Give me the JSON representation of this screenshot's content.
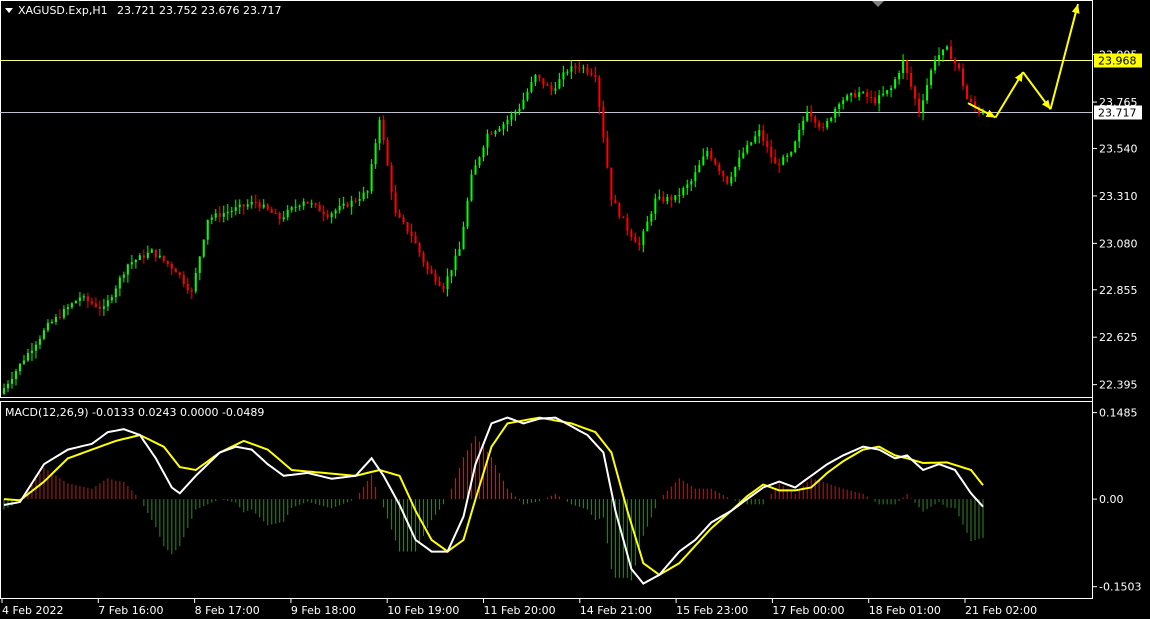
{
  "header": {
    "symbol": "XAGUSD.Exp,H1",
    "ohlc": "23.721 23.752 23.676 23.717"
  },
  "macd_header": "MACD(12,26,9) -0.0133 0.0243 0.0000 -0.0489",
  "colors": {
    "bull": "#00ff00",
    "bear": "#ff0000",
    "macd_line": "#ffffff",
    "signal_line": "#ffff00",
    "hist_pos": "#b22222",
    "hist_neg": "#2e8b22",
    "arrow": "#ffff00",
    "hline": "#ffff80",
    "hline2": "#c0c0d0",
    "tag_bg": "#ffff00",
    "tag_text": "#000000"
  },
  "chart_data": [
    {
      "type": "candlestick",
      "name": "XAGUSD.Exp,H1",
      "y_ticks": [
        "23.995",
        "23.765",
        "23.540",
        "23.310",
        "23.080",
        "22.855",
        "22.625",
        "22.395"
      ],
      "ylim": [
        22.34,
        24.25
      ],
      "x_labels": [
        "4 Feb 2022",
        "7 Feb 16:00",
        "8 Feb 17:00",
        "9 Feb 18:00",
        "10 Feb 19:00",
        "11 Feb 20:00",
        "14 Feb 21:00",
        "15 Feb 23:00",
        "17 Feb 00:00",
        "18 Feb 01:00",
        "21 Feb 02:00"
      ],
      "price_tags": [
        {
          "label": "23.968",
          "value": 23.968,
          "style": "yellow"
        },
        {
          "label": "23.717",
          "value": 23.717,
          "style": "white"
        }
      ],
      "price_path": [
        [
          0,
          22.35
        ],
        [
          6,
          22.52
        ],
        [
          12,
          22.68
        ],
        [
          20,
          22.82
        ],
        [
          26,
          22.76
        ],
        [
          32,
          22.98
        ],
        [
          38,
          23.04
        ],
        [
          44,
          22.95
        ],
        [
          48,
          22.84
        ],
        [
          52,
          23.2
        ],
        [
          58,
          23.24
        ],
        [
          64,
          23.28
        ],
        [
          70,
          23.2
        ],
        [
          76,
          23.29
        ],
        [
          82,
          23.22
        ],
        [
          88,
          23.28
        ],
        [
          92,
          23.33
        ],
        [
          95,
          23.69
        ],
        [
          99,
          23.22
        ],
        [
          103,
          23.12
        ],
        [
          107,
          22.95
        ],
        [
          111,
          22.87
        ],
        [
          115,
          23.05
        ],
        [
          118,
          23.4
        ],
        [
          122,
          23.61
        ],
        [
          126,
          23.66
        ],
        [
          130,
          23.74
        ],
        [
          134,
          23.89
        ],
        [
          138,
          23.82
        ],
        [
          142,
          23.92
        ],
        [
          145,
          23.94
        ],
        [
          149,
          23.9
        ],
        [
          153,
          23.3
        ],
        [
          157,
          23.15
        ],
        [
          160,
          23.07
        ],
        [
          164,
          23.29
        ],
        [
          169,
          23.3
        ],
        [
          173,
          23.38
        ],
        [
          177,
          23.53
        ],
        [
          182,
          23.38
        ],
        [
          186,
          23.52
        ],
        [
          190,
          23.62
        ],
        [
          194,
          23.46
        ],
        [
          198,
          23.51
        ],
        [
          202,
          23.73
        ],
        [
          206,
          23.63
        ],
        [
          210,
          23.77
        ],
        [
          215,
          23.81
        ],
        [
          219,
          23.77
        ],
        [
          223,
          23.83
        ],
        [
          226,
          23.96
        ],
        [
          230,
          23.72
        ],
        [
          234,
          23.98
        ],
        [
          237,
          24.02
        ],
        [
          240,
          23.92
        ],
        [
          242,
          23.78
        ],
        [
          245,
          23.717
        ]
      ],
      "forecast_arrows": [
        {
          "from": [
            23.76,
            0
          ],
          "to": [
            23.69,
            1
          ]
        },
        {
          "from": [
            23.69,
            1
          ],
          "to": [
            23.91,
            2
          ]
        },
        {
          "from": [
            23.91,
            2
          ],
          "to": [
            23.73,
            3
          ]
        },
        {
          "from": [
            23.73,
            3
          ],
          "to": [
            24.24,
            4
          ]
        }
      ]
    },
    {
      "type": "line",
      "name": "MACD(12,26,9)",
      "y_ticks": [
        "0.1485",
        "0.00",
        "-0.1503"
      ],
      "ylim": [
        -0.168,
        0.165
      ],
      "macd": [
        [
          0,
          -0.01
        ],
        [
          4,
          -0.005
        ],
        [
          10,
          0.06
        ],
        [
          16,
          0.085
        ],
        [
          22,
          0.095
        ],
        [
          26,
          0.115
        ],
        [
          30,
          0.12
        ],
        [
          34,
          0.11
        ],
        [
          38,
          0.07
        ],
        [
          42,
          0.02
        ],
        [
          44,
          0.01
        ],
        [
          48,
          0.04
        ],
        [
          54,
          0.08
        ],
        [
          58,
          0.09
        ],
        [
          62,
          0.085
        ],
        [
          66,
          0.06
        ],
        [
          70,
          0.04
        ],
        [
          76,
          0.045
        ],
        [
          82,
          0.035
        ],
        [
          88,
          0.04
        ],
        [
          92,
          0.07
        ],
        [
          95,
          0.04
        ],
        [
          99,
          -0.01
        ],
        [
          103,
          -0.07
        ],
        [
          107,
          -0.09
        ],
        [
          111,
          -0.09
        ],
        [
          115,
          -0.03
        ],
        [
          118,
          0.06
        ],
        [
          122,
          0.13
        ],
        [
          126,
          0.14
        ],
        [
          130,
          0.13
        ],
        [
          134,
          0.138
        ],
        [
          138,
          0.14
        ],
        [
          142,
          0.125
        ],
        [
          146,
          0.11
        ],
        [
          150,
          0.08
        ],
        [
          153,
          -0.02
        ],
        [
          157,
          -0.12
        ],
        [
          160,
          -0.145
        ],
        [
          164,
          -0.13
        ],
        [
          169,
          -0.09
        ],
        [
          173,
          -0.07
        ],
        [
          177,
          -0.04
        ],
        [
          182,
          -0.02
        ],
        [
          186,
          0.0
        ],
        [
          190,
          0.02
        ],
        [
          194,
          0.03
        ],
        [
          198,
          0.02
        ],
        [
          202,
          0.04
        ],
        [
          206,
          0.06
        ],
        [
          210,
          0.075
        ],
        [
          215,
          0.09
        ],
        [
          219,
          0.085
        ],
        [
          223,
          0.07
        ],
        [
          226,
          0.075
        ],
        [
          230,
          0.05
        ],
        [
          234,
          0.06
        ],
        [
          238,
          0.05
        ],
        [
          242,
          0.01
        ],
        [
          245,
          -0.013
        ]
      ],
      "signal": [
        [
          0,
          0.0
        ],
        [
          4,
          -0.002
        ],
        [
          10,
          0.03
        ],
        [
          16,
          0.07
        ],
        [
          22,
          0.085
        ],
        [
          28,
          0.1
        ],
        [
          34,
          0.11
        ],
        [
          40,
          0.09
        ],
        [
          44,
          0.055
        ],
        [
          48,
          0.05
        ],
        [
          54,
          0.08
        ],
        [
          60,
          0.1
        ],
        [
          66,
          0.085
        ],
        [
          72,
          0.05
        ],
        [
          80,
          0.045
        ],
        [
          88,
          0.04
        ],
        [
          94,
          0.05
        ],
        [
          99,
          0.04
        ],
        [
          103,
          -0.02
        ],
        [
          107,
          -0.07
        ],
        [
          111,
          -0.09
        ],
        [
          115,
          -0.07
        ],
        [
          118,
          0.0
        ],
        [
          122,
          0.09
        ],
        [
          126,
          0.13
        ],
        [
          134,
          0.14
        ],
        [
          142,
          0.13
        ],
        [
          148,
          0.115
        ],
        [
          152,
          0.08
        ],
        [
          156,
          -0.02
        ],
        [
          160,
          -0.11
        ],
        [
          164,
          -0.13
        ],
        [
          169,
          -0.11
        ],
        [
          173,
          -0.08
        ],
        [
          177,
          -0.05
        ],
        [
          182,
          -0.02
        ],
        [
          186,
          0.005
        ],
        [
          190,
          0.025
        ],
        [
          194,
          0.015
        ],
        [
          198,
          0.015
        ],
        [
          202,
          0.02
        ],
        [
          206,
          0.045
        ],
        [
          210,
          0.065
        ],
        [
          215,
          0.085
        ],
        [
          219,
          0.09
        ],
        [
          223,
          0.075
        ],
        [
          226,
          0.07
        ],
        [
          230,
          0.062
        ],
        [
          236,
          0.063
        ],
        [
          242,
          0.05
        ],
        [
          245,
          0.024
        ]
      ]
    }
  ]
}
